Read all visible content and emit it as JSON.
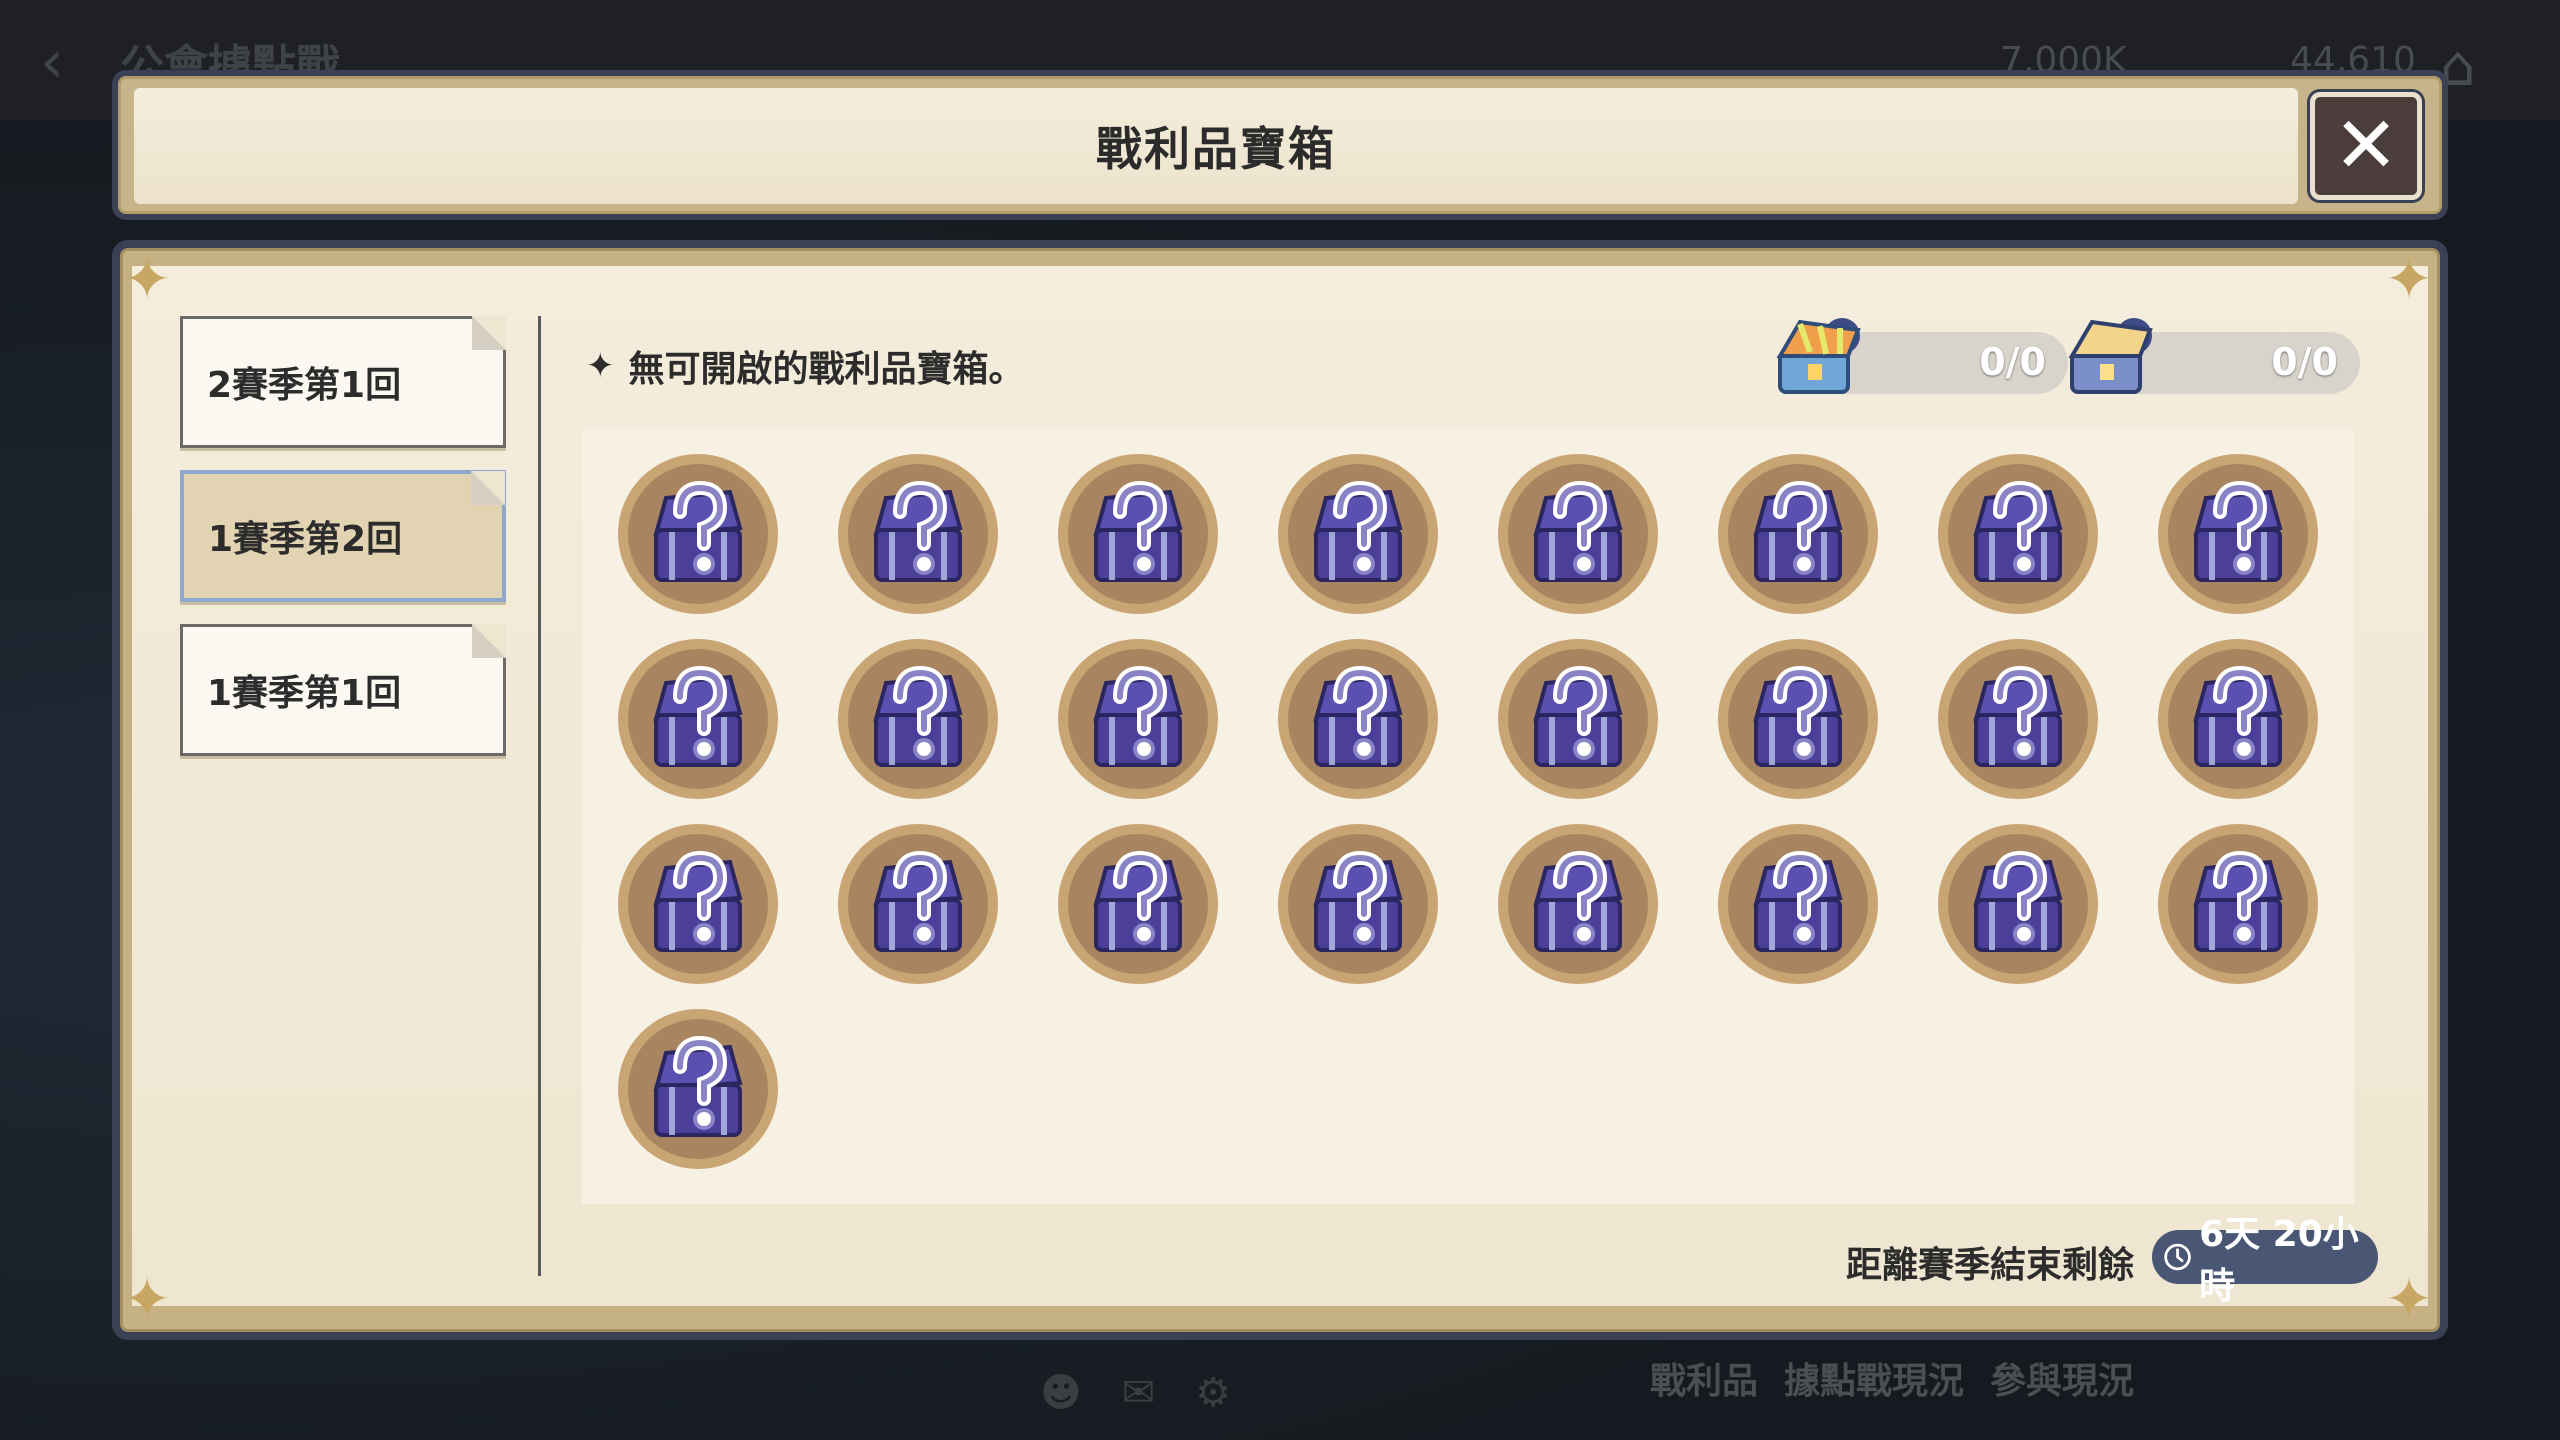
{
  "background": {
    "title": "公會據點戰",
    "resource_1": "7,000K",
    "resource_2": "44,610",
    "bottom_tabs": [
      "戰利品",
      "據點戰現況",
      "參與現況"
    ]
  },
  "dialog": {
    "title": "戰利品寶箱",
    "close_icon": "close-icon"
  },
  "sidebar": {
    "items": [
      {
        "label": "2賽季第1回",
        "active": false
      },
      {
        "label": "1賽季第2回",
        "active": true
      },
      {
        "label": "1賽季第1回",
        "active": false
      }
    ]
  },
  "content": {
    "notice": "無可開啟的戰利品寶箱。",
    "counters": [
      {
        "icon": "rainbow-chest-icon",
        "value": "0/0"
      },
      {
        "icon": "gold-chest-icon",
        "value": "0/0"
      }
    ],
    "chest_count": 25,
    "chest_icon": "mystery-chest-icon"
  },
  "footer": {
    "remain_label": "距離賽季結束剩餘",
    "remain_value": "6天 20小時"
  },
  "colors": {
    "frame": "#3b4154",
    "parchment": "#f4eddc",
    "chest_purple": "#5b4fb0",
    "chest_bg": "#c9a574"
  }
}
